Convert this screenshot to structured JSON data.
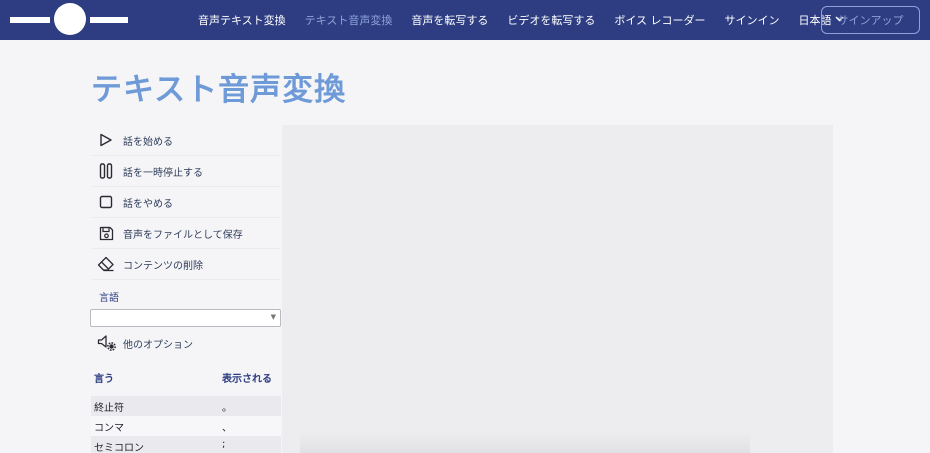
{
  "nav": {
    "links": [
      {
        "label": "音声テキスト変換",
        "active": false
      },
      {
        "label": "テキスト音声変換",
        "active": true
      },
      {
        "label": "音声を転写する",
        "active": false
      },
      {
        "label": "ビデオを転写する",
        "active": false
      },
      {
        "label": "ボイス レコーダー",
        "active": false
      },
      {
        "label": "サインイン",
        "active": false
      }
    ],
    "language": "日本語",
    "signup": "サインアップ"
  },
  "page": {
    "title": "テキスト音声変換"
  },
  "sidebar": {
    "items": [
      {
        "label": "話を始める",
        "icon": "play-icon"
      },
      {
        "label": "話を一時停止する",
        "icon": "pause-icon"
      },
      {
        "label": "話をやめる",
        "icon": "stop-icon"
      },
      {
        "label": "音声をファイルとして保存",
        "icon": "save-icon"
      },
      {
        "label": "コンテンツの削除",
        "icon": "eraser-icon"
      }
    ],
    "language_heading": "言語",
    "language_value": "",
    "more_options": "他のオプション"
  },
  "punctuation": {
    "headers": [
      "言う",
      "表示される"
    ],
    "rows": [
      [
        "終止符",
        "。"
      ],
      [
        "コンマ",
        "、"
      ],
      [
        "セミコロン",
        ";"
      ]
    ]
  },
  "colors": {
    "navbar": "#2e3d82",
    "accent": "#6e9ad8",
    "active_link": "#8ea2d8"
  }
}
